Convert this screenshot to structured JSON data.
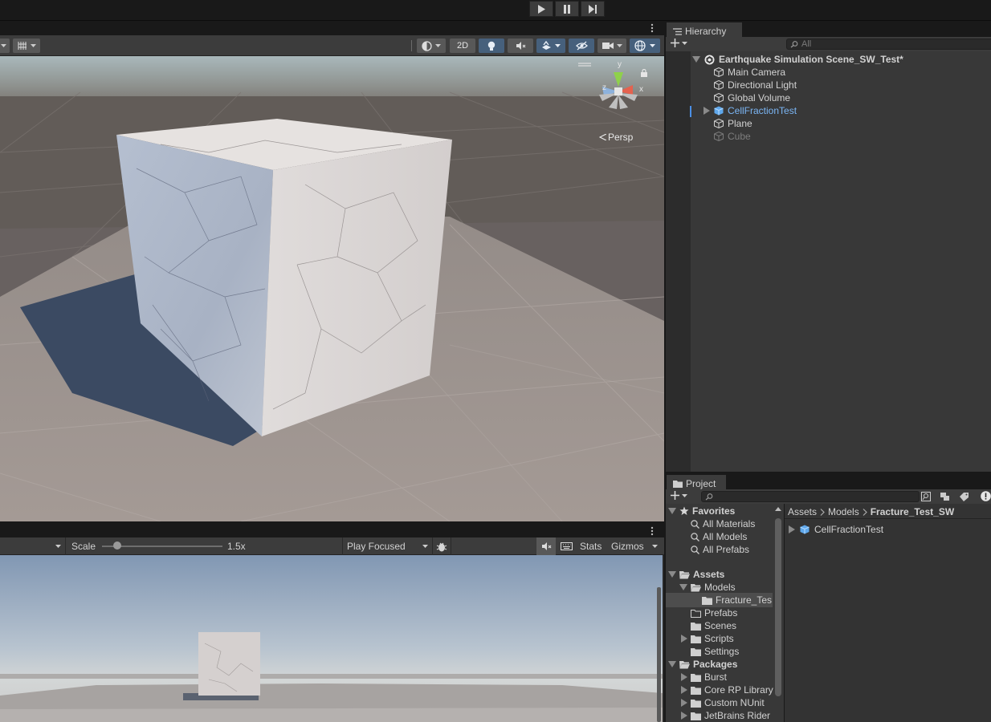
{
  "playbar": {
    "play": "play-icon",
    "pause": "pause-icon",
    "step": "step-icon"
  },
  "scene": {
    "toolbar": {
      "mode_2d": "2D"
    },
    "persp_label": "Persp",
    "gizmo_axes": {
      "y": "y",
      "x": "x",
      "z": "z"
    }
  },
  "game": {
    "scale_label": "Scale",
    "scale_value": 1.5,
    "scale_text": "1.5x",
    "play_mode": "Play Focused",
    "stats_label": "Stats",
    "gizmos_label": "Gizmos"
  },
  "hierarchy": {
    "tab_label": "Hierarchy",
    "search_placeholder": "All",
    "scene_name": "Earthquake Simulation Scene_SW_Test*",
    "items": [
      {
        "label": "Main Camera"
      },
      {
        "label": "Directional Light"
      },
      {
        "label": "Global Volume"
      },
      {
        "label": "CellFractionTest"
      },
      {
        "label": "Plane"
      },
      {
        "label": "Cube"
      }
    ]
  },
  "project": {
    "tab_label": "Project",
    "favorites": {
      "label": "Favorites",
      "items": [
        "All Materials",
        "All Models",
        "All Prefabs"
      ]
    },
    "assets": {
      "label": "Assets",
      "models": "Models",
      "fracture": "Fracture_Tes",
      "prefabs": "Prefabs",
      "scenes": "Scenes",
      "scripts": "Scripts",
      "settings": "Settings"
    },
    "packages": {
      "label": "Packages",
      "items": [
        "Burst",
        "Core RP Library",
        "Custom NUnit",
        "JetBrains Rider"
      ]
    },
    "breadcrumb": [
      "Assets",
      "Models",
      "Fracture_Test_SW"
    ],
    "asset_item": "CellFractionTest"
  },
  "colors": {
    "accent": "#7bb6f5",
    "selection": "#46607c",
    "panel": "#383838"
  }
}
